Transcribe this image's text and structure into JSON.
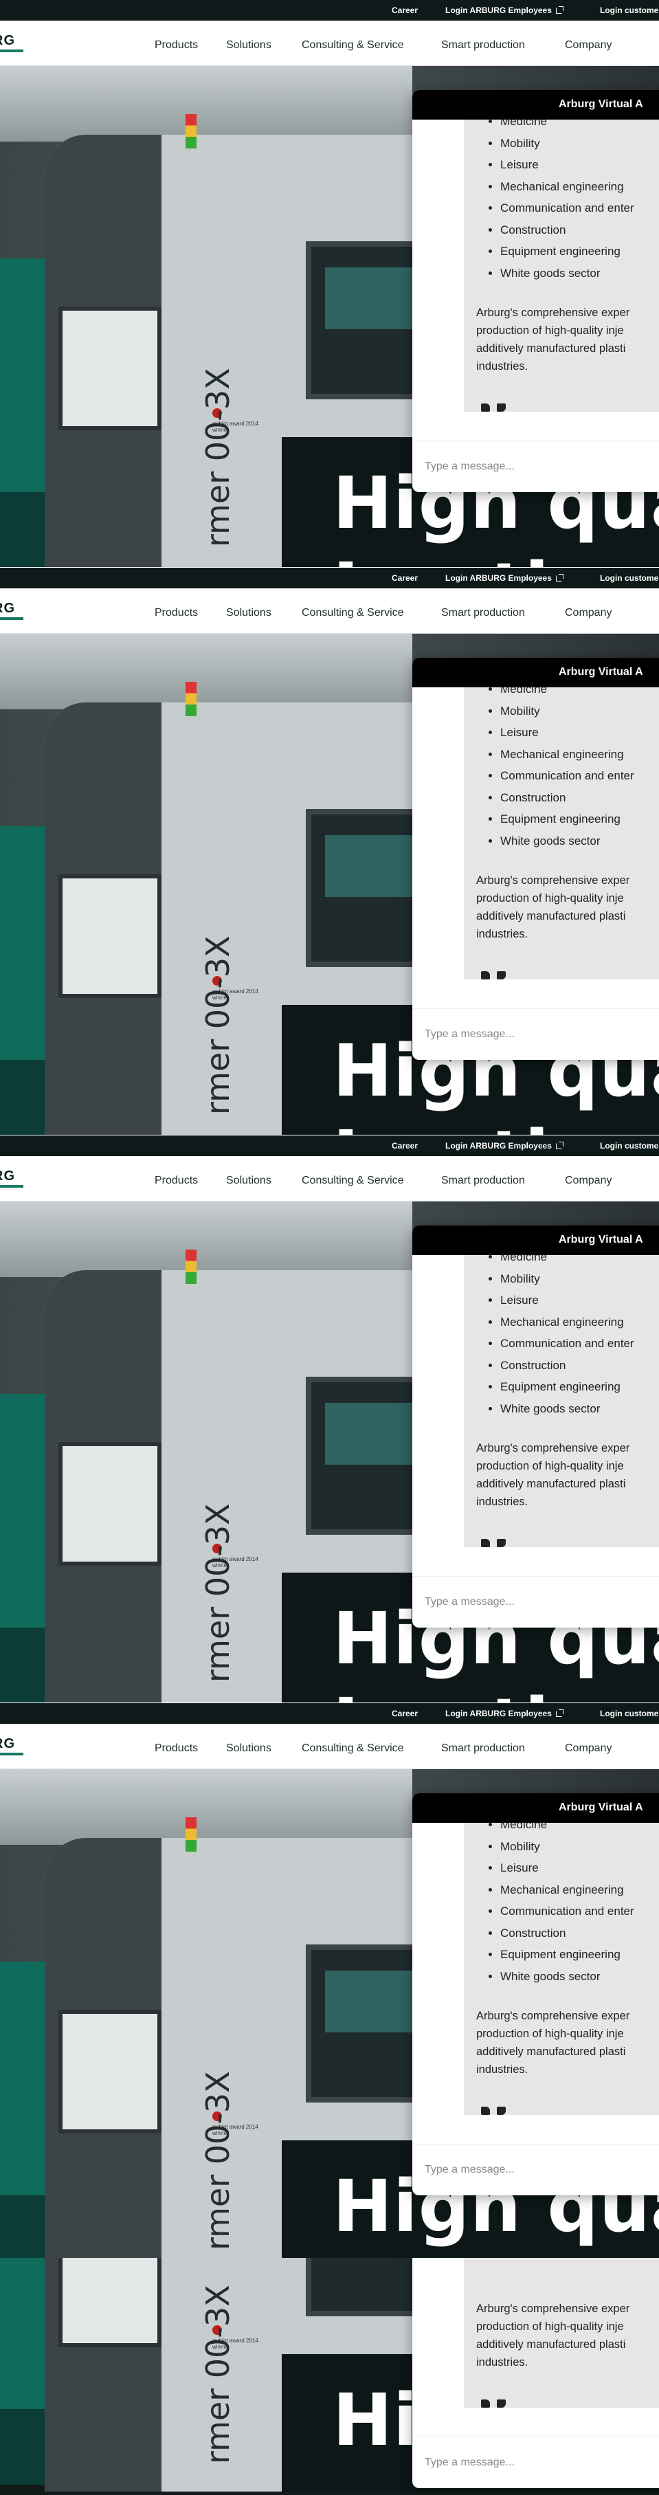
{
  "topbar": {
    "career": "Career",
    "login_employees": "Login ARBURG Employees",
    "login_customers": "Login customers"
  },
  "nav": {
    "logo": "RG",
    "items": [
      "Products",
      "Solutions",
      "Consulting & Service",
      "Smart production",
      "Company"
    ]
  },
  "hero": {
    "vertical_text": "rmer 00-3X",
    "headline_1": "High qual",
    "headline_2": "I ... th",
    "award_text": "reddot award 2014 winner"
  },
  "chat": {
    "title": "Arburg Virtual A",
    "list_items": [
      "Medicine",
      "Mobility",
      "Leisure",
      "Mechanical engineering",
      "Communication and enter",
      "Construction",
      "Equipment engineering",
      "White goods sector"
    ],
    "paragraph_lines": [
      "Arburg's comprehensive exper",
      "production of high-quality inje",
      "additively manufactured plasti",
      "industries."
    ],
    "input_placeholder": "Type a message..."
  },
  "colors": {
    "brand_teal": "#1a7a66",
    "topbar_bg": "#0d1a19",
    "chat_header_bg": "#000000",
    "bubble_bg": "#e6e6e6"
  },
  "icons": [
    "external-link-icon",
    "thumbs-up-icon",
    "thumbs-down-icon"
  ]
}
